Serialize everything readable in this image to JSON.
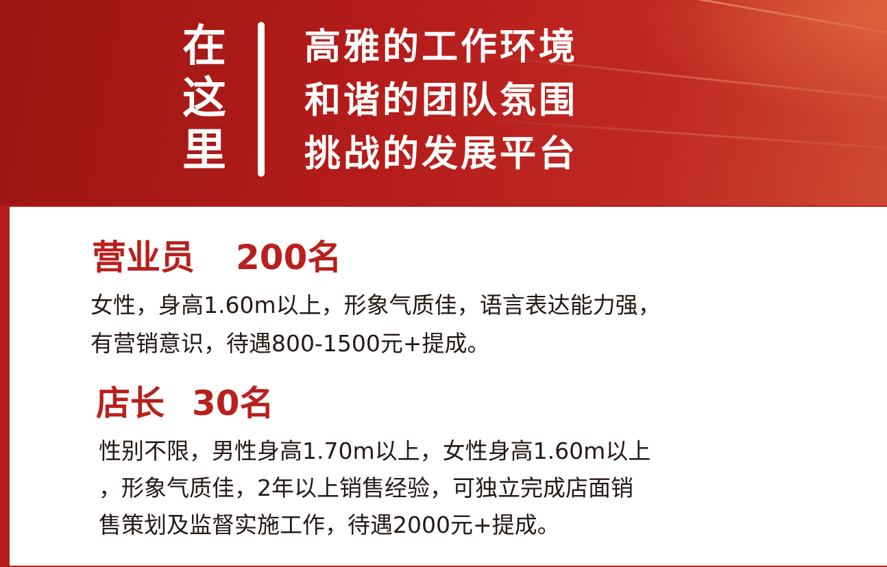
{
  "banner": {
    "vertical_chars": [
      "在",
      "这",
      "里"
    ],
    "slogans": [
      "高雅的工作环境",
      "和谐的团队氛围",
      "挑战的发展平台"
    ]
  },
  "jobs": [
    {
      "role": "营业员",
      "count": "200名",
      "description_lines": [
        "女性，身高1.60m以上，形象气质佳，语言表达能力强，",
        "有营销意识，待遇800-1500元+提成。"
      ]
    },
    {
      "role": "店长",
      "count": "30名",
      "description_lines": [
        "性别不限，男性身高1.70m以上，女性身高1.60m以上",
        "，形象气质佳，2年以上销售经验，可独立完成店面销",
        "售策划及监督实施工作，待遇2000元+提成。"
      ]
    }
  ],
  "colors": {
    "banner_red": "#b51d1b",
    "title_red": "#b8201d",
    "body_text": "#231815"
  }
}
